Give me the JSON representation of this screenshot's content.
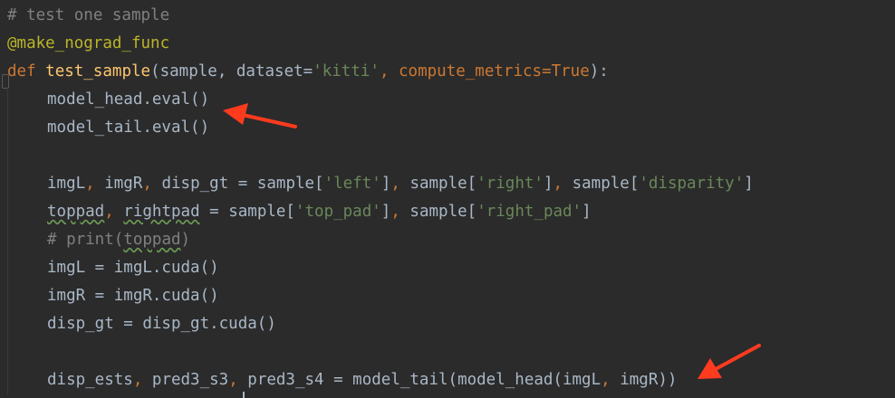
{
  "editor": {
    "lines": {
      "l1": {
        "comment": "# test one sample"
      },
      "l2": {
        "decorator": "@make_nograd_func"
      },
      "l3": {
        "def_kw": "def",
        "fn_name": "test_sample",
        "p1": "(sample, dataset=",
        "s_kitti": "'kitti'",
        "p2": ", compute_metrics=",
        "true_kw": "True",
        "p3": "):"
      },
      "l4": {
        "text": "model_head.eval()"
      },
      "l5": {
        "text": "model_tail.eval()"
      },
      "l7": {
        "t1": "imgL",
        "c1": ",",
        "t2": " imgR",
        "c2": ",",
        "t3": " disp_gt = sample[",
        "s1": "'left'",
        "t4": "]",
        "c3": ",",
        "t5": " sample[",
        "s2": "'right'",
        "t6": "]",
        "c4": ",",
        "t7": " sample[",
        "s3": "'disparity'",
        "t8": "]"
      },
      "l8": {
        "w1": "toppad",
        "c1": ",",
        "sp": " ",
        "w2": "rightpad",
        "t1": " = sample[",
        "s1": "'top_pad'",
        "t2": "]",
        "c2": ",",
        "t3": " sample[",
        "s2": "'right_pad'",
        "t4": "]"
      },
      "l9": {
        "c1": "# print(",
        "w1": "toppad",
        "c2": ")"
      },
      "l10": {
        "text": "imgL = imgL.cuda()"
      },
      "l11": {
        "text": "imgR = imgR.cuda()"
      },
      "l12": {
        "text": "disp_gt = disp_gt.cuda()"
      },
      "l14": {
        "t1": "disp_ests",
        "c1": ",",
        "t2": " pred3_s3",
        "c2": ",",
        "t3": " pred3_s4 = model_tail(model_head(imgL",
        "c3": ",",
        "t4": " imgR))"
      }
    }
  },
  "colors": {
    "background": "#2b2b2b",
    "text": "#a9b7c6",
    "keyword": "#cc7832",
    "function": "#ffc66d",
    "string": "#6a8759",
    "comment": "#808080",
    "decorator": "#bbb529",
    "annotation_arrow": "#ff3b1f"
  },
  "annotations": [
    "red-arrow-pointing-to-eval-calls",
    "red-arrow-pointing-to-model-call"
  ]
}
